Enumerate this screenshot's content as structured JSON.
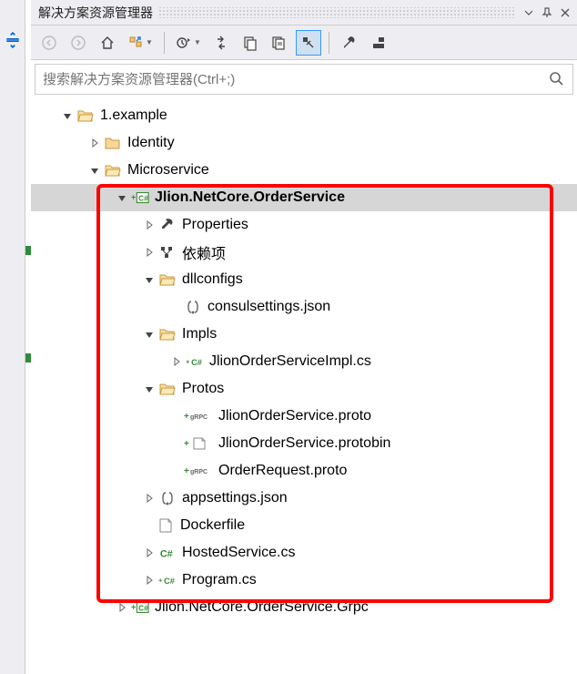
{
  "title": "解决方案资源管理器",
  "search": {
    "placeholder": "搜索解决方案资源管理器(Ctrl+;)"
  },
  "tree": {
    "n0": "1.example",
    "n1": "Identity",
    "n2": "Microservice",
    "n3": "Jlion.NetCore.OrderService",
    "n4": "Properties",
    "n5": "依赖项",
    "n6": "dllconfigs",
    "n7": "consulsettings.json",
    "n8": "Impls",
    "n9": "JlionOrderServiceImpl.cs",
    "n10": "Protos",
    "n11": "JlionOrderService.proto",
    "n12": "JlionOrderService.protobin",
    "n13": "OrderRequest.proto",
    "n14": "appsettings.json",
    "n15": "Dockerfile",
    "n16": "HostedService.cs",
    "n17": "Program.cs",
    "n18": "Jlion.NetCore.OrderService.Grpc"
  }
}
